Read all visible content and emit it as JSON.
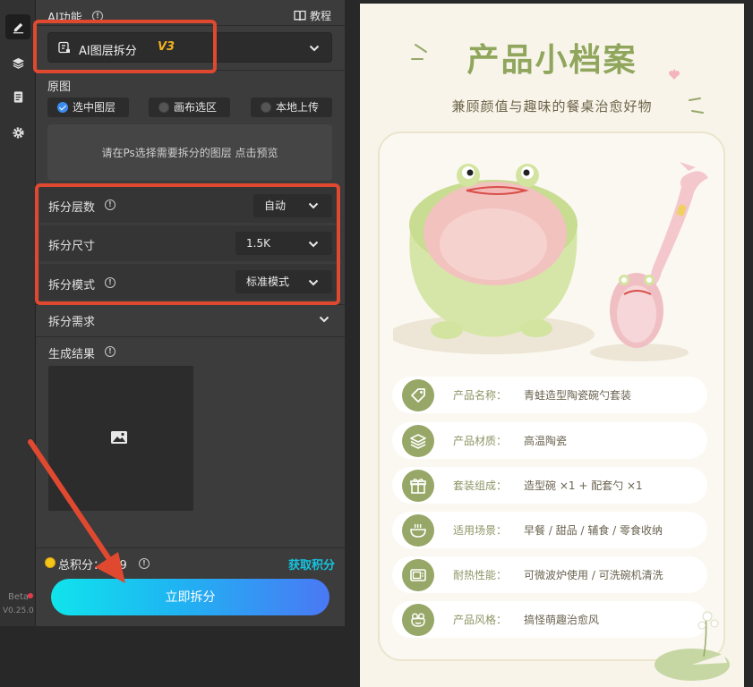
{
  "rail": {
    "icons": [
      "pencil-icon",
      "layers-icon",
      "document-icon",
      "gear-icon"
    ],
    "beta_label": "Beta",
    "version": "V0.25.0"
  },
  "panel": {
    "ai_function_label": "AI功能",
    "tutorial_label": "教程",
    "feature_select": {
      "value": "AI图层拆分",
      "version_badge": "V3"
    },
    "source_label": "原图",
    "source_options": [
      {
        "label": "选中图层",
        "selected": true
      },
      {
        "label": "画布选区",
        "selected": false
      },
      {
        "label": "本地上传",
        "selected": false
      }
    ],
    "upload_hint": "请在Ps选择需要拆分的图层",
    "upload_hint_link": "点击预览",
    "settings": [
      {
        "label": "拆分层数",
        "value": "自动",
        "has_info": true
      },
      {
        "label": "拆分尺寸",
        "value": "1.5K",
        "has_info": false
      },
      {
        "label": "拆分模式",
        "value": "标准模式",
        "has_info": true
      }
    ],
    "requirements_label": "拆分需求",
    "result_label": "生成结果",
    "points_label": "总积分：",
    "points_value": "999",
    "get_points_label": "获取积分",
    "split_button_label": "立即拆分",
    "accent_color": "#14c4e0",
    "highlight_color": "#e0492f"
  },
  "card": {
    "title": "产品小档案",
    "subtitle": "兼顾颜值与趣味的餐桌治愈好物",
    "items": [
      {
        "icon": "tag-icon",
        "key": "产品名称：",
        "value": "青蛙造型陶瓷碗勺套装"
      },
      {
        "icon": "stack-icon",
        "key": "产品材质：",
        "value": "高温陶瓷"
      },
      {
        "icon": "gift-icon",
        "key": "套装组成：",
        "value": "造型碗 ×1 + 配套勺 ×1"
      },
      {
        "icon": "bowl-icon",
        "key": "适用场景：",
        "value": "早餐 / 甜品 / 辅食 / 零食收纳"
      },
      {
        "icon": "microwave-icon",
        "key": "耐热性能：",
        "value": "可微波炉使用 / 可洗碗机清洗"
      },
      {
        "icon": "frog-face-icon",
        "key": "产品风格：",
        "value": "搞怪萌趣治愈风"
      }
    ],
    "title_color": "#8fa65c",
    "icon_color": "#97a767"
  }
}
